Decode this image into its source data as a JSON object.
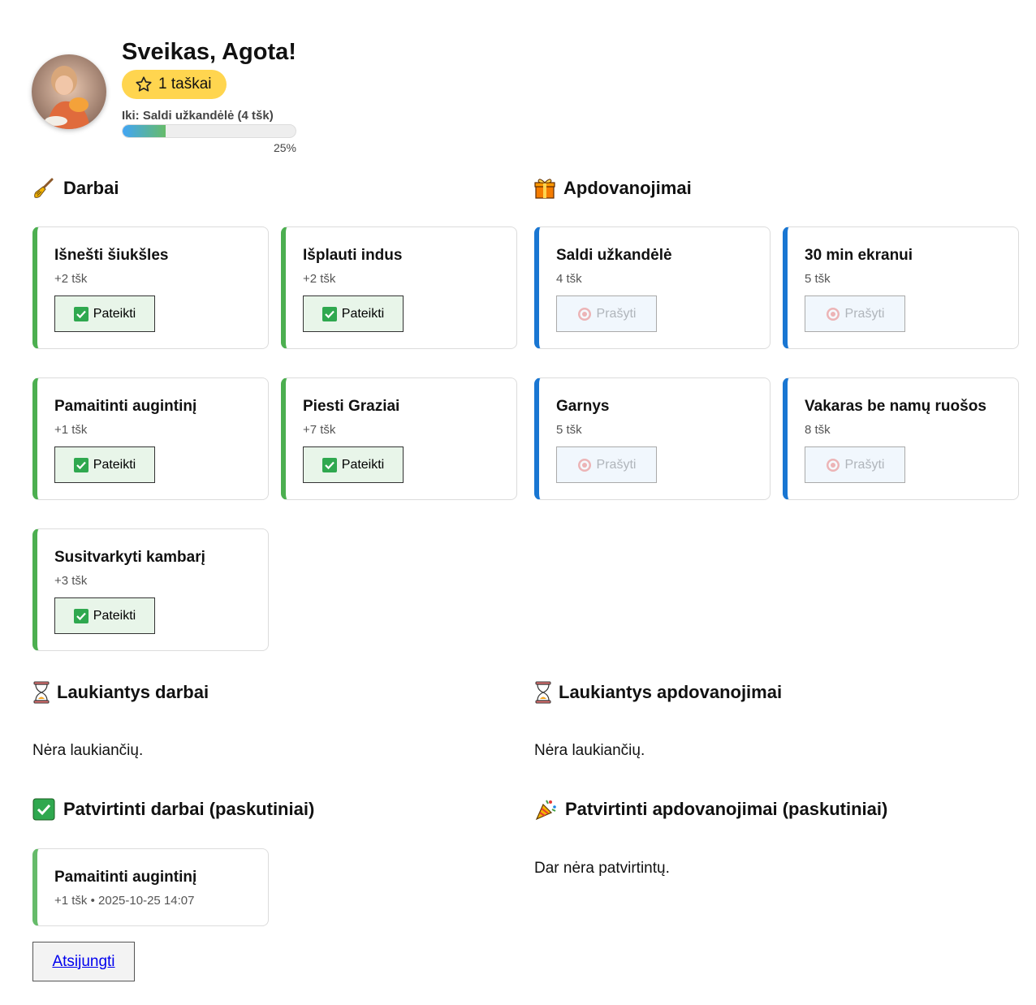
{
  "header": {
    "greeting": "Sveikas, Agota!",
    "points_label": "1 taškai",
    "goal_label": "Iki: Saldi užkandėlė (4 tšk)",
    "progress_fraction": 0.25,
    "progress_text": "25%"
  },
  "chores": {
    "title": "Darbai",
    "submit_label": "Pateikti",
    "items": [
      {
        "name": "Išnešti šiukšles",
        "points": "+2 tšk"
      },
      {
        "name": "Išplauti indus",
        "points": "+2 tšk"
      },
      {
        "name": "Pamaitinti augintinį",
        "points": "+1 tšk"
      },
      {
        "name": "Piesti Graziai",
        "points": "+7 tšk"
      },
      {
        "name": "Susitvarkyti kambarį",
        "points": "+3 tšk"
      }
    ]
  },
  "rewards": {
    "title": "Apdovanojimai",
    "request_label": "Prašyti",
    "items": [
      {
        "name": "Saldi užkandėlė",
        "cost": "4 tšk"
      },
      {
        "name": "30 min ekranui",
        "cost": "5 tšk"
      },
      {
        "name": "Garnys",
        "cost": "5 tšk"
      },
      {
        "name": "Vakaras be namų ruošos",
        "cost": "8 tšk"
      }
    ]
  },
  "pending_chores": {
    "title": "Laukiantys darbai",
    "empty": "Nėra laukiančių."
  },
  "pending_rewards": {
    "title": "Laukiantys apdovanojimai",
    "empty": "Nėra laukiančių."
  },
  "approved_chores": {
    "title": "Patvirtinti darbai (paskutiniai)",
    "items": [
      {
        "name": "Pamaitinti augintinį",
        "meta": "+1 tšk • 2025-10-25 14:07"
      }
    ]
  },
  "approved_rewards": {
    "title": "Patvirtinti apdovanojimai (paskutiniai)",
    "empty": "Dar nėra patvirtintų."
  },
  "logout_label": "Atsijungti",
  "colors": {
    "chore_accent": "#4caf50",
    "reward_accent": "#1976d2",
    "points_badge": "#ffd54f"
  }
}
